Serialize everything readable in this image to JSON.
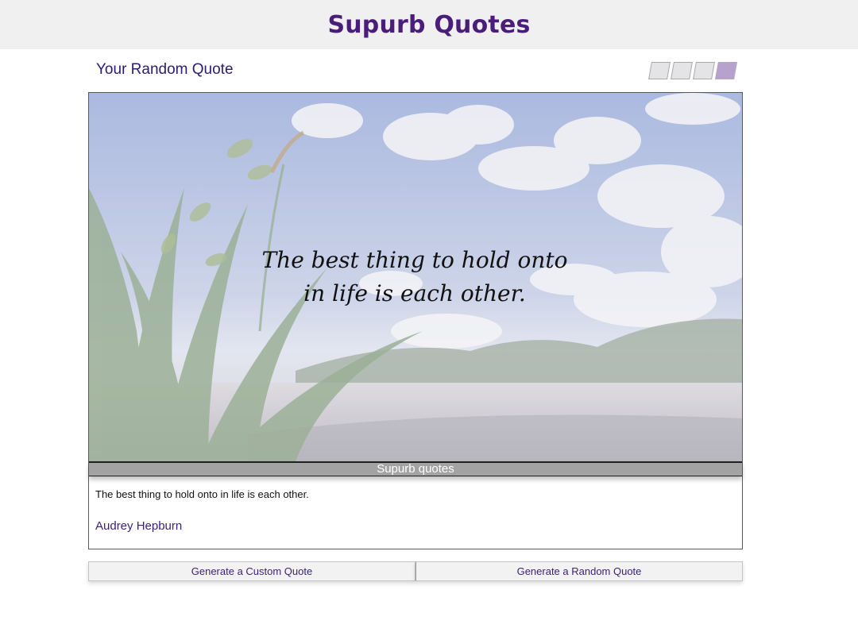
{
  "header": {
    "site_title": "Supurb Quotes"
  },
  "section": {
    "title": "Your Random Quote"
  },
  "theme_swatches": [
    {
      "name": "theme-1",
      "active": false
    },
    {
      "name": "theme-2",
      "active": false
    },
    {
      "name": "theme-3",
      "active": false
    },
    {
      "name": "theme-4",
      "active": true
    }
  ],
  "quote_card": {
    "overlay_text": "The best thing to hold onto in life is each other.",
    "caption": "Supurb quotes",
    "quote_text": "The best thing to hold onto in life is each other.",
    "author": "Audrey Hepburn"
  },
  "actions": {
    "custom_label": "Generate a Custom Quote",
    "random_label": "Generate a Random Quote"
  },
  "colors": {
    "brand_purple": "#4b1d7a",
    "active_swatch": "#b6a2cd",
    "caption_bg": "#a3a3a3"
  }
}
